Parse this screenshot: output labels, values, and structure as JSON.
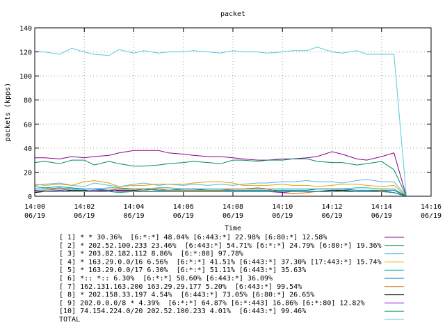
{
  "chart_data": {
    "type": "line",
    "title": "packet",
    "xlabel": "Time",
    "ylabel": "packets (kpps)",
    "ylim": [
      0,
      140
    ],
    "yticks": [
      0,
      20,
      40,
      60,
      80,
      100,
      120,
      140
    ],
    "xticks": [
      {
        "time": "14:00",
        "date": "06/19",
        "minute": 0
      },
      {
        "time": "14:02",
        "date": "06/19",
        "minute": 2
      },
      {
        "time": "14:04",
        "date": "06/19",
        "minute": 4
      },
      {
        "time": "14:06",
        "date": "06/19",
        "minute": 6
      },
      {
        "time": "14:08",
        "date": "06/19",
        "minute": 8
      },
      {
        "time": "14:10",
        "date": "06/19",
        "minute": 10
      },
      {
        "time": "14:12",
        "date": "06/19",
        "minute": 12
      },
      {
        "time": "14:14",
        "date": "06/19",
        "minute": 14
      },
      {
        "time": "14:16",
        "date": "06/19",
        "minute": 16
      }
    ],
    "xlim_minutes": [
      0,
      16
    ],
    "x_minutes": [
      0,
      0.4,
      1,
      1.5,
      2,
      2.4,
      3,
      3.4,
      4,
      4.4,
      5,
      5.4,
      6,
      6.4,
      7,
      7.5,
      8,
      8.4,
      9,
      9.4,
      10,
      10.4,
      11,
      11.4,
      12,
      12.4,
      13,
      13.4,
      14,
      14.5,
      15
    ],
    "legend_placement": "bottom",
    "series": [
      {
        "label": "[ 1] * * 30.36%  [6:*:*] 48.04% [6:443:*] 22.98% [6:80:*] 12.58%",
        "color": "#8b008b",
        "values": [
          32,
          32,
          31,
          33,
          32,
          33,
          34,
          36,
          38,
          38,
          38,
          36,
          35,
          34,
          33,
          33,
          32,
          31,
          30,
          30,
          31,
          31,
          32,
          33,
          37,
          35,
          31,
          30,
          33,
          36,
          0
        ]
      },
      {
        "label": "[ 2] * 202.52.100.233 23.46%  [6:443:*] 54.71% [6:*:*] 24.79% [6:80:*] 19.36%",
        "color": "#008b5a",
        "values": [
          28,
          29,
          27,
          30,
          30,
          26,
          29,
          27,
          25,
          25,
          26,
          27,
          28,
          29,
          28,
          27,
          30,
          30,
          29,
          30,
          30,
          31,
          31,
          29,
          28,
          28,
          26,
          27,
          29,
          22,
          0
        ]
      },
      {
        "label": "[ 3] * 203.82.182.112 8.86%  [6:*:80] 97.78%",
        "color": "#56b4e9",
        "values": [
          9,
          10,
          11,
          9,
          8,
          11,
          9,
          8,
          10,
          11,
          9,
          10,
          9,
          10,
          9,
          10,
          9,
          10,
          11,
          11,
          12,
          12,
          13,
          12,
          12,
          11,
          13,
          14,
          12,
          12,
          0
        ]
      },
      {
        "label": "[ 4] * 163.29.0.0/16 6.56%  [6:*:*] 41.51% [6:443:*] 37.30% [17:443:*] 15.74%",
        "color": "#e69f00",
        "values": [
          10,
          9,
          10,
          9,
          12,
          13,
          11,
          8,
          9,
          9,
          10,
          10,
          10,
          11,
          12,
          12,
          11,
          9,
          9,
          9,
          10,
          9,
          9,
          8,
          9,
          10,
          10,
          9,
          8,
          9,
          0
        ]
      },
      {
        "label": "[ 5] * 163.29.0.0/17 6.30%  [6:*:*] 51.11% [6:443:*] 35.63%",
        "color": "#00b0a0",
        "values": [
          8,
          7,
          8,
          7,
          6,
          6,
          7,
          7,
          6,
          6,
          7,
          7,
          6,
          6,
          6,
          6,
          6,
          6,
          6,
          6,
          6,
          6,
          6,
          6,
          6,
          6,
          7,
          7,
          6,
          6,
          0
        ]
      },
      {
        "label": "[ 6] *:: *:: 6.30%  [6:*:*] 58.60% [6:443:*] 36.09%",
        "color": "#0072b2",
        "values": [
          6,
          6,
          7,
          6,
          6,
          6,
          5,
          6,
          6,
          6,
          5,
          5,
          6,
          6,
          5,
          5,
          5,
          5,
          5,
          5,
          5,
          5,
          5,
          6,
          6,
          6,
          5,
          5,
          5,
          5,
          0
        ]
      },
      {
        "label": "[ 7] 162.131.163.200 163.29.29.177 5.20%  [6:443:*] 99.54%",
        "color": "#d55e00",
        "values": [
          4,
          5,
          6,
          5,
          5,
          4,
          5,
          6,
          6,
          5,
          6,
          5,
          5,
          5,
          5,
          5,
          6,
          6,
          7,
          6,
          3,
          2,
          3,
          4,
          4,
          5,
          4,
          4,
          5,
          3,
          0
        ]
      },
      {
        "label": "[ 8] * 202.158.33.197 4.54%  [6:443:*] 73.05% [6:80:*] 26.65%",
        "color": "#000000",
        "values": [
          3,
          4,
          4,
          5,
          5,
          4,
          4,
          5,
          5,
          4,
          4,
          4,
          4,
          4,
          4,
          4,
          4,
          4,
          4,
          4,
          4,
          4,
          4,
          4,
          5,
          5,
          4,
          4,
          4,
          3,
          0
        ]
      },
      {
        "label": "[ 9] 202.0.0.0/8 * 4.39%  [6:*:*] 64.87% [6:*:443] 16.86% [6:*:80] 12.82%",
        "color": "#9400d3",
        "values": [
          5,
          4,
          5,
          4,
          4,
          5,
          5,
          4,
          4,
          4,
          4,
          4,
          4,
          4,
          4,
          4,
          4,
          4,
          4,
          4,
          3,
          4,
          4,
          4,
          4,
          4,
          4,
          4,
          4,
          3,
          0
        ]
      },
      {
        "label": "[10] 74.154.224.0/20 202.52.100.233 4.01%  [6:443:*] 99.46%",
        "color": "#009e73",
        "values": [
          4,
          4,
          4,
          4,
          4,
          4,
          4,
          3,
          4,
          4,
          4,
          4,
          4,
          4,
          4,
          4,
          4,
          4,
          4,
          4,
          4,
          4,
          4,
          4,
          4,
          4,
          4,
          4,
          4,
          3,
          0
        ]
      },
      {
        "label": "TOTAL",
        "color": "#56c8e0",
        "values": [
          120,
          120,
          118,
          123,
          120,
          118,
          117,
          122,
          119,
          121,
          119,
          120,
          120,
          121,
          120,
          119,
          121,
          120,
          120,
          119,
          120,
          121,
          121,
          124,
          120,
          119,
          121,
          118,
          118,
          118,
          0
        ]
      }
    ]
  }
}
